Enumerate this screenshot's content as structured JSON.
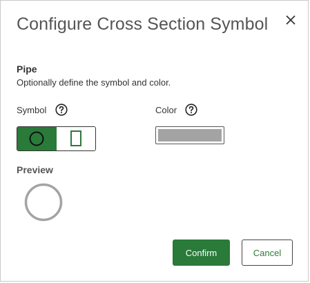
{
  "dialog": {
    "title": "Configure Cross Section Symbol",
    "close_icon": "close-icon"
  },
  "section": {
    "title": "Pipe",
    "description": "Optionally define the symbol and color."
  },
  "symbol": {
    "label": "Symbol",
    "help_icon": "question-circle-icon",
    "options": [
      {
        "name": "circle",
        "selected": true
      },
      {
        "name": "rectangle",
        "selected": false
      }
    ]
  },
  "color": {
    "label": "Color",
    "help_icon": "question-circle-icon",
    "value": "#a3a3a3"
  },
  "preview": {
    "title": "Preview",
    "shape": "circle",
    "stroke_color": "#a3a3a3"
  },
  "buttons": {
    "confirm_label": "Confirm",
    "cancel_label": "Cancel"
  },
  "theme": {
    "accent": "#2a7a3a"
  }
}
